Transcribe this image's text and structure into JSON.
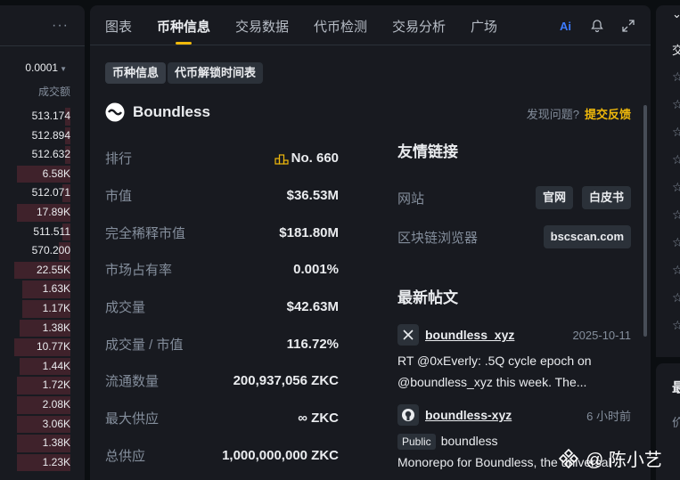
{
  "orderbook": {
    "more_label": "···",
    "tick_size": "0.0001",
    "column_header": "成交额",
    "rows": [
      {
        "value": "513.174",
        "fill": 0.1
      },
      {
        "value": "512.894",
        "fill": 0.1
      },
      {
        "value": "512.632",
        "fill": 0.1
      },
      {
        "value": "6.58K",
        "fill": 0.95
      },
      {
        "value": "512.071",
        "fill": 0.15
      },
      {
        "value": "17.89K",
        "fill": 0.95
      },
      {
        "value": "511.511",
        "fill": 0.15
      },
      {
        "value": "570.200",
        "fill": 0.2
      },
      {
        "value": "22.55K",
        "fill": 1.0
      },
      {
        "value": "1.63K",
        "fill": 0.85
      },
      {
        "value": "1.17K",
        "fill": 0.85
      },
      {
        "value": "1.38K",
        "fill": 0.9
      },
      {
        "value": "10.77K",
        "fill": 1.0
      },
      {
        "value": "1.44K",
        "fill": 0.9
      },
      {
        "value": "1.72K",
        "fill": 0.95
      },
      {
        "value": "2.08K",
        "fill": 0.95
      },
      {
        "value": "3.06K",
        "fill": 0.95
      },
      {
        "value": "1.38K",
        "fill": 0.95
      },
      {
        "value": "1.23K",
        "fill": 0.95
      }
    ]
  },
  "tabs": [
    {
      "label": "图表"
    },
    {
      "label": "币种信息"
    },
    {
      "label": "交易数据"
    },
    {
      "label": "代币检测"
    },
    {
      "label": "交易分析"
    },
    {
      "label": "广场"
    }
  ],
  "icons": {
    "ai": "ai-icon",
    "bell": "bell-icon",
    "expand": "expand-icon"
  },
  "subtabs": [
    {
      "label": "币种信息"
    },
    {
      "label": "代币解锁时间表"
    }
  ],
  "coin": {
    "name": "Boundless",
    "feedback_question": "发现问题?",
    "feedback_link": "提交反馈"
  },
  "stats": [
    {
      "label": "排行",
      "value": "No. 660"
    },
    {
      "label": "市值",
      "value": "$36.53M"
    },
    {
      "label": "完全稀释市值",
      "value": "$181.80M"
    },
    {
      "label": "市场占有率",
      "value": "0.001%"
    },
    {
      "label": "成交量",
      "value": "$42.63M"
    },
    {
      "label": "成交量 / 市值",
      "value": "116.72%"
    },
    {
      "label": "流通数量",
      "value": "200,937,056 ZKC"
    },
    {
      "label": "最大供应",
      "value": "∞ ZKC"
    },
    {
      "label": "总供应",
      "value": "1,000,000,000 ZKC"
    }
  ],
  "links": {
    "title": "友情链接",
    "website_label": "网站",
    "website_buttons": [
      "官网",
      "白皮书"
    ],
    "explorer_label": "区块链浏览器",
    "explorer_button": "bscscan.com"
  },
  "posts": {
    "title": "最新帖文",
    "items": [
      {
        "platform": "x-icon",
        "author": "boundless_xyz",
        "time": "2025-10-11",
        "text": "RT @0xEverly: .5Q cycle epoch on @boundless_xyz this week. The..."
      },
      {
        "platform": "github-icon",
        "author": "boundless-xyz",
        "time": "6 小时前",
        "badge": "Public",
        "repo": "boundless",
        "text": "Monorepo for Boundless, the universal"
      }
    ]
  },
  "watermark": {
    "text": "@ 陈小艺"
  },
  "right_edge": {
    "label_top": "交",
    "label_bottom": "最",
    "label_bottom2": "价"
  },
  "colors": {
    "accent": "#f0b90b",
    "background": "#0b0e11",
    "panel": "#181a20",
    "sell_bar": "#f6465d"
  }
}
